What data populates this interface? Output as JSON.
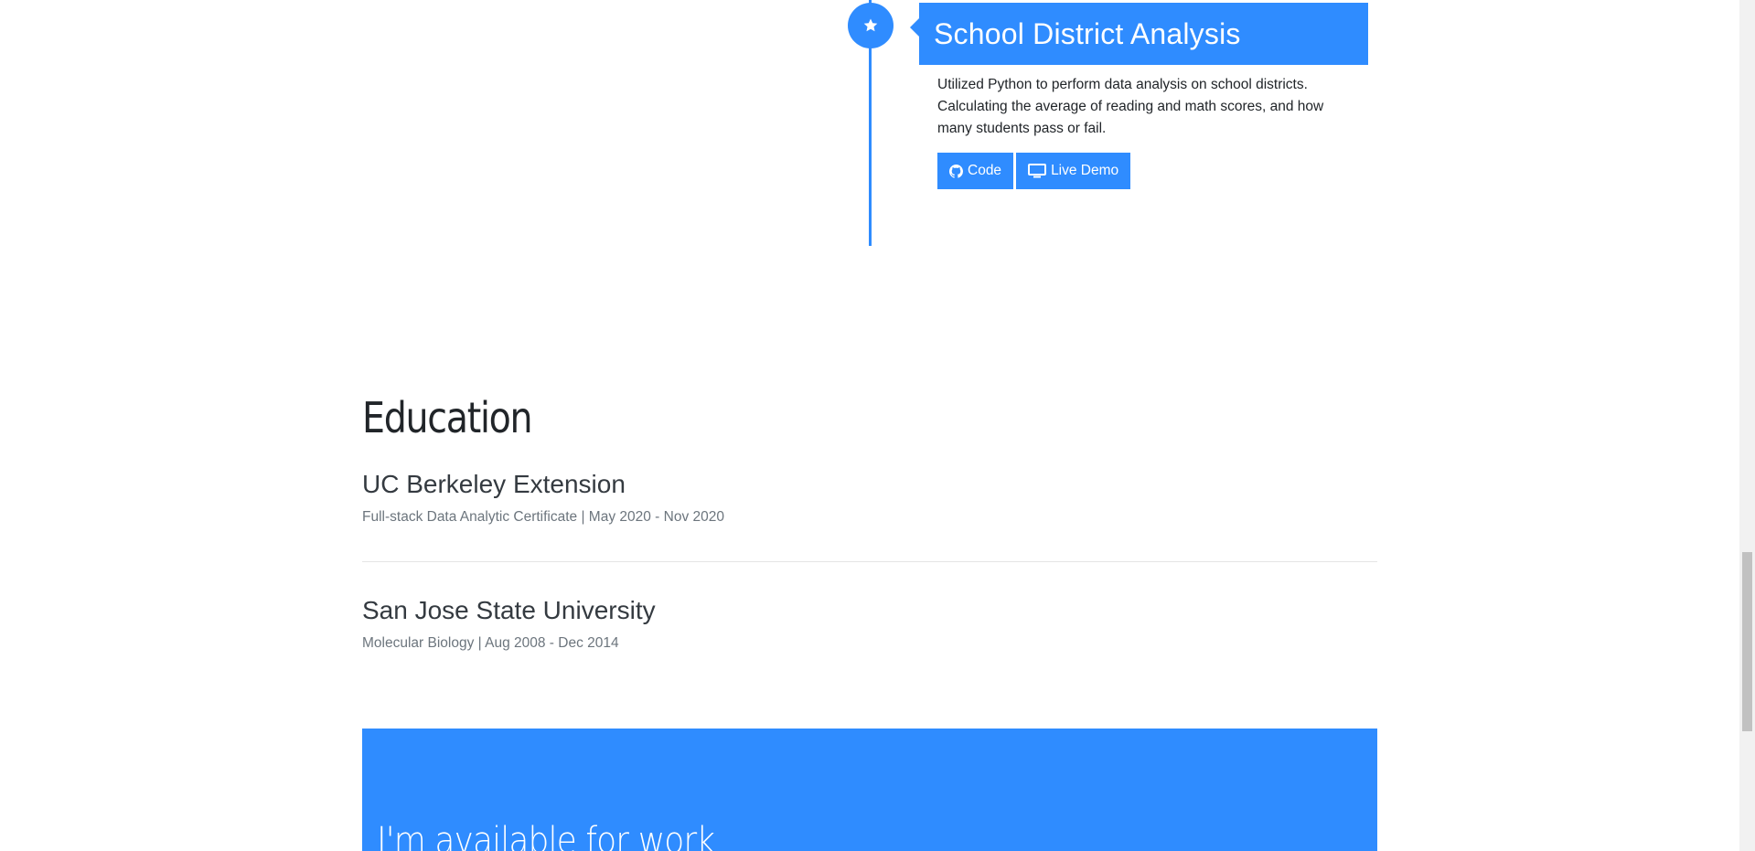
{
  "timeline": {
    "badge_icon": "star-icon",
    "title": "School District Analysis",
    "description": "Utilized Python to perform data analysis on school districts. Calculating the average of reading and math scores, and how many students pass or fail.",
    "buttons": [
      {
        "label": "Code",
        "icon": "github-icon"
      },
      {
        "label": "Live Demo",
        "icon": "desktop-icon"
      }
    ]
  },
  "education": {
    "heading": "Education",
    "schools": [
      {
        "name": "UC Berkeley Extension",
        "details": "Full-stack Data Analytic Certificate | May 2020 - Nov 2020"
      },
      {
        "name": "San Jose State University",
        "details": "Molecular Biology | Aug 2008 - Dec 2014"
      }
    ]
  },
  "cta": {
    "title": "I'm available for work"
  },
  "colors": {
    "accent": "#2f8cff",
    "text": "#212529",
    "muted": "#6c757d"
  }
}
